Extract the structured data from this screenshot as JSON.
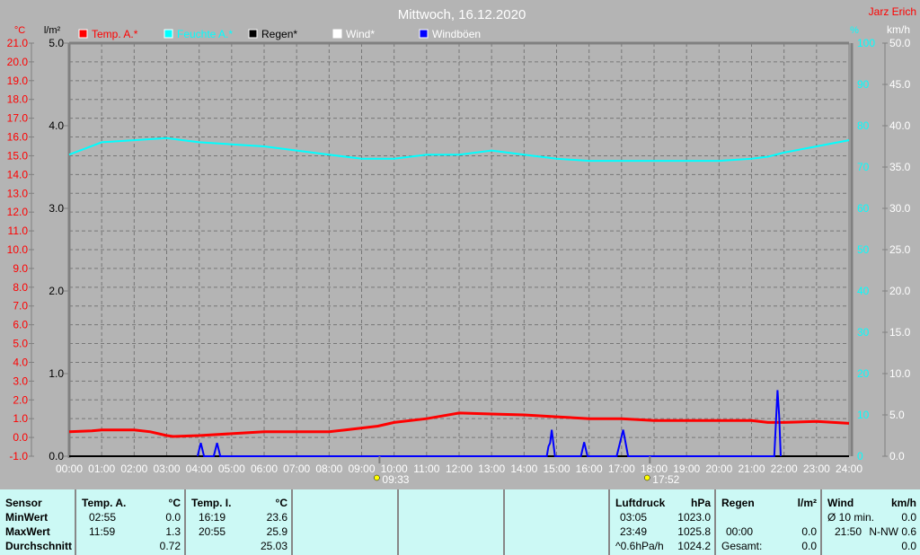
{
  "title": "Mittwoch, 16.12.2020",
  "author": "Jarz Erich",
  "colors": {
    "background": "#b4b4b4",
    "temp": "#ff0000",
    "humidity": "#00ffff",
    "rain": "#000000",
    "wind": "#ffffff",
    "gust": "#0000ff",
    "table": "#ccf9f5"
  },
  "chart_data": {
    "type": "line",
    "title": "Mittwoch, 16.12.2020",
    "grid": true,
    "legend_placement": "top",
    "x_ticks": [
      "00:00",
      "01:00",
      "02:00",
      "03:00",
      "04:00",
      "05:00",
      "06:00",
      "07:00",
      "08:00",
      "09:00",
      "10:00",
      "11:00",
      "12:00",
      "13:00",
      "14:00",
      "15:00",
      "16:00",
      "17:00",
      "18:00",
      "19:00",
      "20:00",
      "21:00",
      "22:00",
      "23:00",
      "24:00"
    ],
    "xlim_hours": [
      0,
      24
    ],
    "axes": {
      "temp": {
        "unit": "°C",
        "ylim": [
          -1,
          21
        ],
        "step": 1
      },
      "rain": {
        "unit": "l/m²",
        "ylim": [
          0,
          5
        ],
        "step": 1
      },
      "humidity": {
        "unit": "%",
        "ylim": [
          0,
          100
        ],
        "step": 10
      },
      "wind": {
        "unit": "km/h",
        "ylim": [
          0,
          50
        ],
        "step": 5
      }
    },
    "series": [
      {
        "name": "Temp. A.*",
        "axis": "temp",
        "color": "#ff0000",
        "points": [
          [
            0,
            0.3
          ],
          [
            0.7,
            0.35
          ],
          [
            1,
            0.4
          ],
          [
            2,
            0.4
          ],
          [
            2.5,
            0.3
          ],
          [
            3,
            0.1
          ],
          [
            3.2,
            0.05
          ],
          [
            4,
            0.1
          ],
          [
            5,
            0.2
          ],
          [
            6,
            0.3
          ],
          [
            7,
            0.3
          ],
          [
            8,
            0.3
          ],
          [
            8.5,
            0.4
          ],
          [
            9,
            0.5
          ],
          [
            9.5,
            0.6
          ],
          [
            10,
            0.8
          ],
          [
            11,
            1.0
          ],
          [
            12,
            1.3
          ],
          [
            13,
            1.25
          ],
          [
            14,
            1.2
          ],
          [
            15,
            1.1
          ],
          [
            16,
            1.0
          ],
          [
            17,
            1.0
          ],
          [
            17.5,
            0.95
          ],
          [
            18,
            0.9
          ],
          [
            21,
            0.9
          ],
          [
            21.5,
            0.8
          ],
          [
            22,
            0.8
          ],
          [
            23,
            0.85
          ],
          [
            24,
            0.75
          ]
        ]
      },
      {
        "name": "Feuchte A.*",
        "axis": "humidity",
        "color": "#00ffff",
        "points": [
          [
            0,
            73
          ],
          [
            0.5,
            74.5
          ],
          [
            1,
            76
          ],
          [
            2,
            76.5
          ],
          [
            3,
            77
          ],
          [
            3.5,
            76.5
          ],
          [
            4,
            76
          ],
          [
            5,
            75.5
          ],
          [
            6,
            75
          ],
          [
            7,
            74
          ],
          [
            8,
            73
          ],
          [
            9,
            72
          ],
          [
            10,
            72
          ],
          [
            11,
            73
          ],
          [
            12,
            73
          ],
          [
            13,
            74
          ],
          [
            14,
            73
          ],
          [
            15,
            72
          ],
          [
            16,
            71.5
          ],
          [
            20,
            71.5
          ],
          [
            21,
            72
          ],
          [
            21.5,
            72.5
          ],
          [
            22,
            73.5
          ],
          [
            23,
            75
          ],
          [
            24,
            76.5
          ]
        ]
      },
      {
        "name": "Regen*",
        "axis": "rain",
        "color": "#000000",
        "points": [
          [
            0,
            0
          ],
          [
            24,
            0
          ]
        ]
      },
      {
        "name": "Wind*",
        "axis": "wind",
        "color": "#ffffff",
        "points": []
      },
      {
        "name": "Windböen",
        "axis": "wind",
        "color": "#0000ff",
        "points": [
          [
            3.95,
            0
          ],
          [
            4.05,
            1.6
          ],
          [
            4.15,
            0
          ],
          [
            4.45,
            0
          ],
          [
            4.55,
            1.6
          ],
          [
            4.65,
            0
          ],
          [
            14.7,
            0
          ],
          [
            14.75,
            1.2
          ],
          [
            14.8,
            1.6
          ],
          [
            14.85,
            3.2
          ],
          [
            14.95,
            0
          ],
          [
            15.75,
            0
          ],
          [
            15.85,
            1.7
          ],
          [
            15.95,
            0
          ],
          [
            16.85,
            0
          ],
          [
            17.05,
            3.2
          ],
          [
            17.2,
            0
          ],
          [
            21.7,
            0
          ],
          [
            21.8,
            8.0
          ],
          [
            21.85,
            5.0
          ],
          [
            21.9,
            0
          ]
        ]
      }
    ],
    "annotations": [
      {
        "type": "sunrise",
        "time": "09:33",
        "hour": 9.55
      },
      {
        "type": "sunset",
        "time": "17:52",
        "hour": 17.87
      }
    ]
  },
  "table": {
    "sensor": {
      "header": "Sensor",
      "rows": [
        "MinWert",
        "MaxWert",
        "Durchschnitt"
      ]
    },
    "temp_a": {
      "header": "Temp. A.",
      "unit": "°C",
      "min_time": "02:55",
      "min": "0.0",
      "max_time": "11:59",
      "max": "1.3",
      "avg": "0.72"
    },
    "temp_i": {
      "header": "Temp. I.",
      "unit": "°C",
      "min_time": "16:19",
      "min": "23.6",
      "max_time": "20:55",
      "max": "25.9",
      "avg": "25.03"
    },
    "pressure": {
      "header": "Luftdruck",
      "unit": "hPa",
      "min_time": "03:05",
      "min": "1023.0",
      "max_time": "23:49",
      "max": "1025.8",
      "trend": "^0.6hPa/h",
      "avg": "1024.2"
    },
    "rain": {
      "header": "Regen",
      "unit": "l/m²",
      "time": "00:00",
      "value": "0.0",
      "total_label": "Gesamt:",
      "total": "0.0"
    },
    "wind": {
      "header": "Wind",
      "unit": "km/h",
      "avg_label": "Ø 10 min.",
      "avg": "0.0",
      "max_time": "21:50",
      "max": "N-NW 0.6",
      "last": "0.0"
    }
  }
}
